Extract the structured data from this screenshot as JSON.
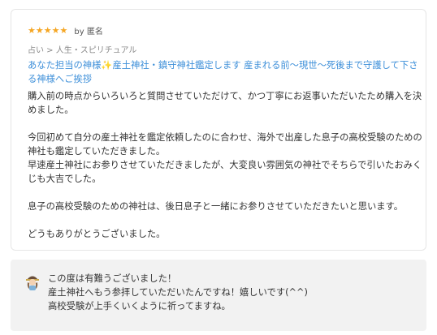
{
  "review": {
    "rating": 5,
    "star_glyph": "★",
    "star_color": "#f5a623",
    "author": "by 匿名",
    "category": "占い > 人生・スピリチュアル",
    "service_title": "あなた担当の神様✨産土神社・鎮守神社鑑定します 産まれる前〜現世〜死後まで守護して下さる神様へご挨拶",
    "link_color": "#3d8fd9",
    "paragraphs": [
      [
        "購入前の時点からいろいろと質問させていただけて、かつ丁寧にお返事いただいたため購入を決めました。"
      ],
      [
        "今回初めて自分の産土神社を鑑定依頼したのに合わせ、海外で出産した息子の高校受験のための神社も鑑定していただきました。",
        "早速産土神社にお参りさせていただきましたが、大変良い雰囲気の神社でそちらで引いたおみくじも大吉でした。"
      ],
      [
        "息子の高校受験のための神社は、後日息子と一緒にお参りさせていただきたいと思います。"
      ],
      [
        "どうもありがとうございました。"
      ]
    ]
  },
  "reply": {
    "avatar_icon": "seller-avatar-icon",
    "lines": [
      "この度は有難うございました！",
      "産土神社へもう参拝していただいたんですね！嬉しいです(^^)",
      "高校受験が上手くいくように祈ってますね。"
    ]
  }
}
